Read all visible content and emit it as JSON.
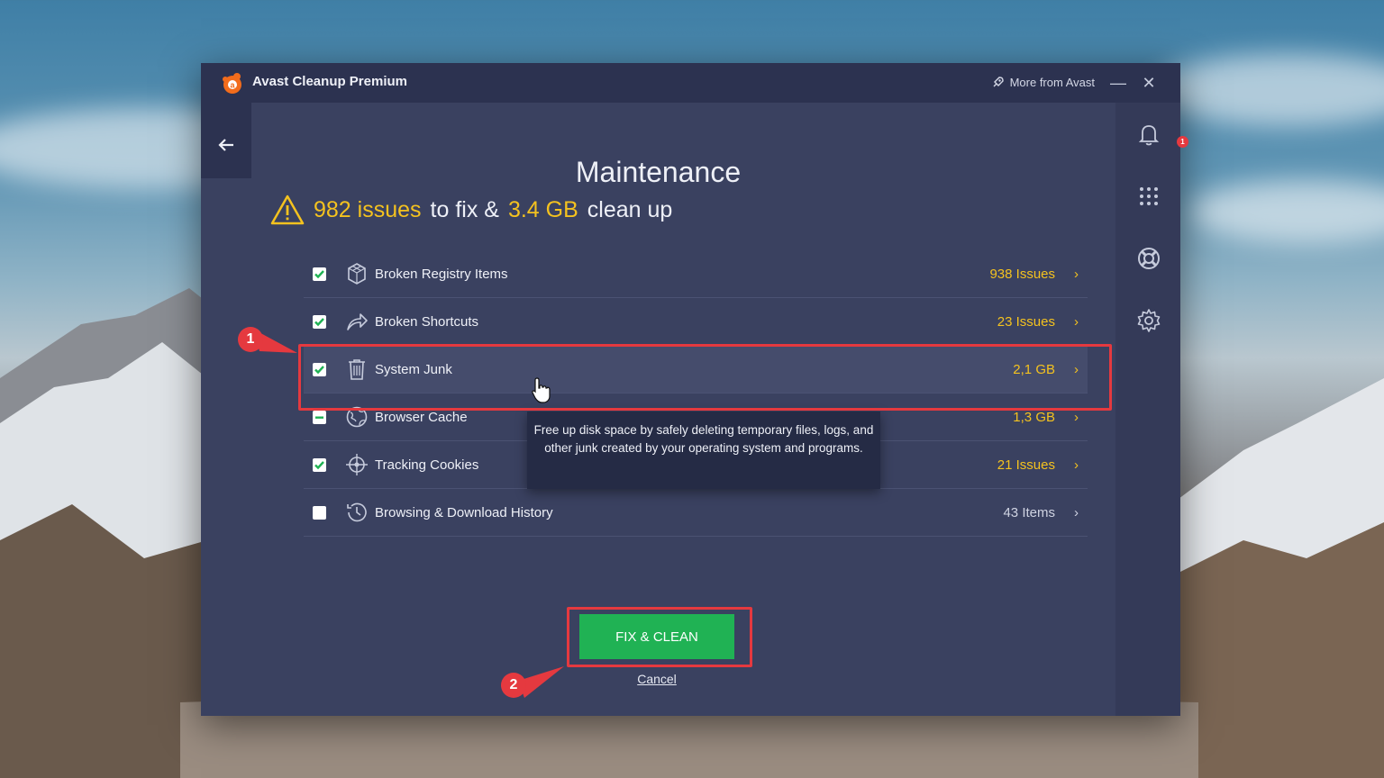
{
  "window": {
    "app_title": "Avast Cleanup Premium",
    "more_from": "More from Avast",
    "minimize": "—",
    "close": "✕"
  },
  "page": {
    "title": "Maintenance",
    "summary": {
      "issues_count": "982 issues",
      "mid1": "to fix &",
      "size": "3.4 GB",
      "mid2": "clean up"
    }
  },
  "rail": {
    "notification_count": "1"
  },
  "items": [
    {
      "label": "Broken Registry Items",
      "value": "938 Issues",
      "checked": "checked",
      "icon": "registry-icon"
    },
    {
      "label": "Broken Shortcuts",
      "value": "23 Issues",
      "checked": "checked",
      "icon": "shortcut-icon"
    },
    {
      "label": "System Junk",
      "value": "2,1 GB",
      "checked": "checked",
      "icon": "trash-icon"
    },
    {
      "label": "Browser Cache",
      "value": "1,3 GB",
      "checked": "partial",
      "icon": "globe-icon"
    },
    {
      "label": "Tracking Cookies",
      "value": "21 Issues",
      "checked": "checked",
      "icon": "crosshair-icon"
    },
    {
      "label": "Browsing & Download History",
      "value": "43 Items",
      "checked": "unchecked",
      "icon": "history-icon"
    }
  ],
  "tooltip": {
    "text": "Free up disk space by safely deleting temporary files, logs, and other junk created by your operating system and programs."
  },
  "actions": {
    "fix_clean": "FIX & CLEAN",
    "cancel": "Cancel"
  },
  "annotations": {
    "first": "1",
    "second": "2"
  },
  "colors": {
    "accent_yellow": "#f4c21f",
    "button_green": "#20b254",
    "annotation_red": "#e5393f",
    "window_bg": "#3a4160"
  }
}
